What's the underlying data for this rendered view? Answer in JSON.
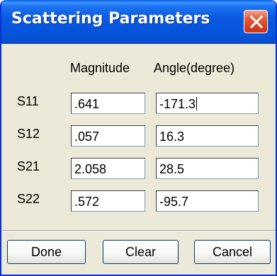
{
  "window": {
    "title": "Scattering Parameters"
  },
  "icons": {
    "close": "close-icon"
  },
  "colors": {
    "titlebar": "#0a5ae0",
    "close_button": "#d4401e",
    "dialog_background": "#ece9d8"
  },
  "headers": {
    "magnitude": "Magnitude",
    "angle": "Angle(degree)"
  },
  "rows": [
    {
      "label": "S11",
      "magnitude": ".641",
      "angle": "-171.3"
    },
    {
      "label": "S12",
      "magnitude": ".057",
      "angle": "16.3"
    },
    {
      "label": "S21",
      "magnitude": "2.058",
      "angle": "28.5"
    },
    {
      "label": "S22",
      "magnitude": ".572",
      "angle": "-95.7"
    }
  ],
  "buttons": {
    "done": "Done",
    "clear": "Clear",
    "cancel": "Cancel"
  }
}
